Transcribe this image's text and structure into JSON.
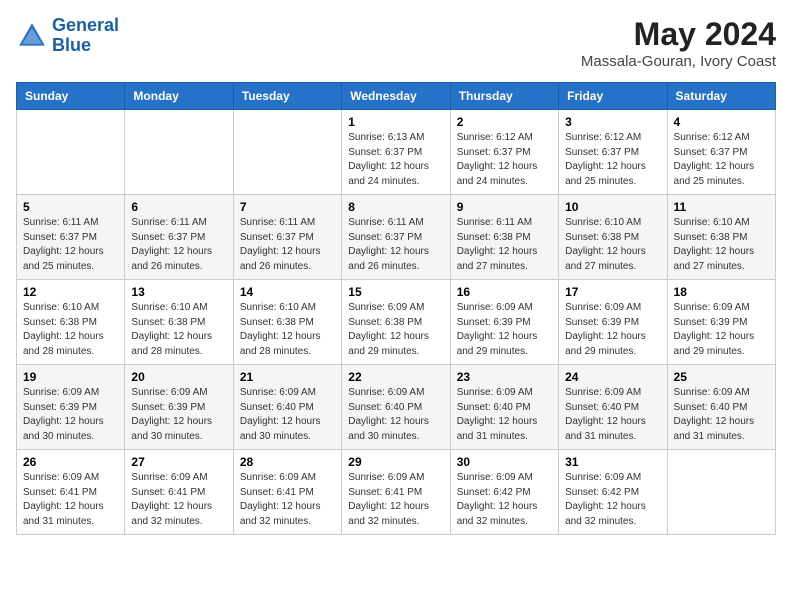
{
  "header": {
    "logo_line1": "General",
    "logo_line2": "Blue",
    "month_title": "May 2024",
    "location": "Massala-Gouran, Ivory Coast"
  },
  "days_of_week": [
    "Sunday",
    "Monday",
    "Tuesday",
    "Wednesday",
    "Thursday",
    "Friday",
    "Saturday"
  ],
  "weeks": [
    [
      {
        "day": "",
        "info": ""
      },
      {
        "day": "",
        "info": ""
      },
      {
        "day": "",
        "info": ""
      },
      {
        "day": "1",
        "info": "Sunrise: 6:13 AM\nSunset: 6:37 PM\nDaylight: 12 hours\nand 24 minutes."
      },
      {
        "day": "2",
        "info": "Sunrise: 6:12 AM\nSunset: 6:37 PM\nDaylight: 12 hours\nand 24 minutes."
      },
      {
        "day": "3",
        "info": "Sunrise: 6:12 AM\nSunset: 6:37 PM\nDaylight: 12 hours\nand 25 minutes."
      },
      {
        "day": "4",
        "info": "Sunrise: 6:12 AM\nSunset: 6:37 PM\nDaylight: 12 hours\nand 25 minutes."
      }
    ],
    [
      {
        "day": "5",
        "info": "Sunrise: 6:11 AM\nSunset: 6:37 PM\nDaylight: 12 hours\nand 25 minutes."
      },
      {
        "day": "6",
        "info": "Sunrise: 6:11 AM\nSunset: 6:37 PM\nDaylight: 12 hours\nand 26 minutes."
      },
      {
        "day": "7",
        "info": "Sunrise: 6:11 AM\nSunset: 6:37 PM\nDaylight: 12 hours\nand 26 minutes."
      },
      {
        "day": "8",
        "info": "Sunrise: 6:11 AM\nSunset: 6:37 PM\nDaylight: 12 hours\nand 26 minutes."
      },
      {
        "day": "9",
        "info": "Sunrise: 6:11 AM\nSunset: 6:38 PM\nDaylight: 12 hours\nand 27 minutes."
      },
      {
        "day": "10",
        "info": "Sunrise: 6:10 AM\nSunset: 6:38 PM\nDaylight: 12 hours\nand 27 minutes."
      },
      {
        "day": "11",
        "info": "Sunrise: 6:10 AM\nSunset: 6:38 PM\nDaylight: 12 hours\nand 27 minutes."
      }
    ],
    [
      {
        "day": "12",
        "info": "Sunrise: 6:10 AM\nSunset: 6:38 PM\nDaylight: 12 hours\nand 28 minutes."
      },
      {
        "day": "13",
        "info": "Sunrise: 6:10 AM\nSunset: 6:38 PM\nDaylight: 12 hours\nand 28 minutes."
      },
      {
        "day": "14",
        "info": "Sunrise: 6:10 AM\nSunset: 6:38 PM\nDaylight: 12 hours\nand 28 minutes."
      },
      {
        "day": "15",
        "info": "Sunrise: 6:09 AM\nSunset: 6:38 PM\nDaylight: 12 hours\nand 29 minutes."
      },
      {
        "day": "16",
        "info": "Sunrise: 6:09 AM\nSunset: 6:39 PM\nDaylight: 12 hours\nand 29 minutes."
      },
      {
        "day": "17",
        "info": "Sunrise: 6:09 AM\nSunset: 6:39 PM\nDaylight: 12 hours\nand 29 minutes."
      },
      {
        "day": "18",
        "info": "Sunrise: 6:09 AM\nSunset: 6:39 PM\nDaylight: 12 hours\nand 29 minutes."
      }
    ],
    [
      {
        "day": "19",
        "info": "Sunrise: 6:09 AM\nSunset: 6:39 PM\nDaylight: 12 hours\nand 30 minutes."
      },
      {
        "day": "20",
        "info": "Sunrise: 6:09 AM\nSunset: 6:39 PM\nDaylight: 12 hours\nand 30 minutes."
      },
      {
        "day": "21",
        "info": "Sunrise: 6:09 AM\nSunset: 6:40 PM\nDaylight: 12 hours\nand 30 minutes."
      },
      {
        "day": "22",
        "info": "Sunrise: 6:09 AM\nSunset: 6:40 PM\nDaylight: 12 hours\nand 30 minutes."
      },
      {
        "day": "23",
        "info": "Sunrise: 6:09 AM\nSunset: 6:40 PM\nDaylight: 12 hours\nand 31 minutes."
      },
      {
        "day": "24",
        "info": "Sunrise: 6:09 AM\nSunset: 6:40 PM\nDaylight: 12 hours\nand 31 minutes."
      },
      {
        "day": "25",
        "info": "Sunrise: 6:09 AM\nSunset: 6:40 PM\nDaylight: 12 hours\nand 31 minutes."
      }
    ],
    [
      {
        "day": "26",
        "info": "Sunrise: 6:09 AM\nSunset: 6:41 PM\nDaylight: 12 hours\nand 31 minutes."
      },
      {
        "day": "27",
        "info": "Sunrise: 6:09 AM\nSunset: 6:41 PM\nDaylight: 12 hours\nand 32 minutes."
      },
      {
        "day": "28",
        "info": "Sunrise: 6:09 AM\nSunset: 6:41 PM\nDaylight: 12 hours\nand 32 minutes."
      },
      {
        "day": "29",
        "info": "Sunrise: 6:09 AM\nSunset: 6:41 PM\nDaylight: 12 hours\nand 32 minutes."
      },
      {
        "day": "30",
        "info": "Sunrise: 6:09 AM\nSunset: 6:42 PM\nDaylight: 12 hours\nand 32 minutes."
      },
      {
        "day": "31",
        "info": "Sunrise: 6:09 AM\nSunset: 6:42 PM\nDaylight: 12 hours\nand 32 minutes."
      },
      {
        "day": "",
        "info": ""
      }
    ]
  ]
}
